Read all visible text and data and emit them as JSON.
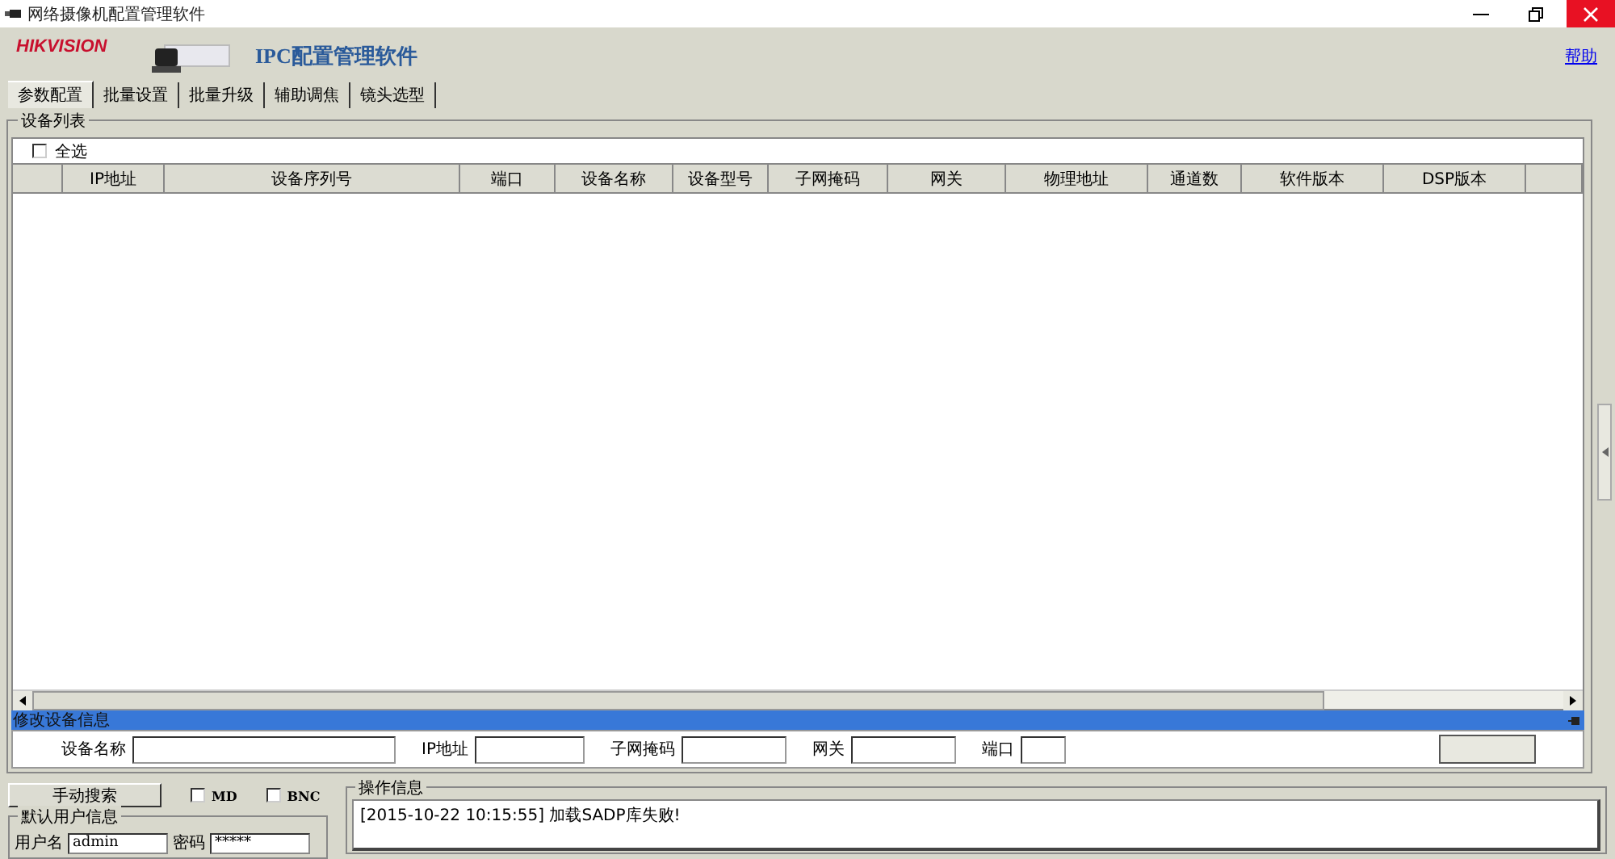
{
  "window": {
    "title": "网络摄像机配置管理软件"
  },
  "banner": {
    "brand": "HIKVISION",
    "product": "IPC配置管理软件",
    "help_link": "帮助"
  },
  "tabs": [
    {
      "label": "参数配置",
      "selected": true
    },
    {
      "label": "批量设置",
      "selected": false
    },
    {
      "label": "批量升级",
      "selected": false
    },
    {
      "label": "辅助调焦",
      "selected": false
    },
    {
      "label": "镜头选型",
      "selected": false
    }
  ],
  "device_list": {
    "title": "设备列表",
    "select_all": {
      "label": "全选",
      "checked": false
    },
    "columns": [
      "IP地址",
      "设备序列号",
      "端口",
      "设备名称",
      "设备型号",
      "子网掩码",
      "网关",
      "物理地址",
      "通道数",
      "软件版本",
      "DSP版本"
    ]
  },
  "edit_panel": {
    "title": "修改设备信息",
    "fields": [
      {
        "label": "设备名称"
      },
      {
        "label": "IP地址"
      },
      {
        "label": "子网掩码"
      },
      {
        "label": "网关"
      },
      {
        "label": "端口"
      }
    ]
  },
  "search_button": "手动搜索",
  "options": [
    {
      "label": "MD",
      "checked": false
    },
    {
      "label": "BNC",
      "checked": false
    }
  ],
  "default_user": {
    "title": "默认用户信息",
    "username_label": "用户名",
    "username": "admin",
    "password_label": "密码",
    "password": "*****"
  },
  "log": {
    "title": "操作信息",
    "lines": [
      "[2015-10-22 10:15:55] 加载SADP库失败!"
    ]
  }
}
